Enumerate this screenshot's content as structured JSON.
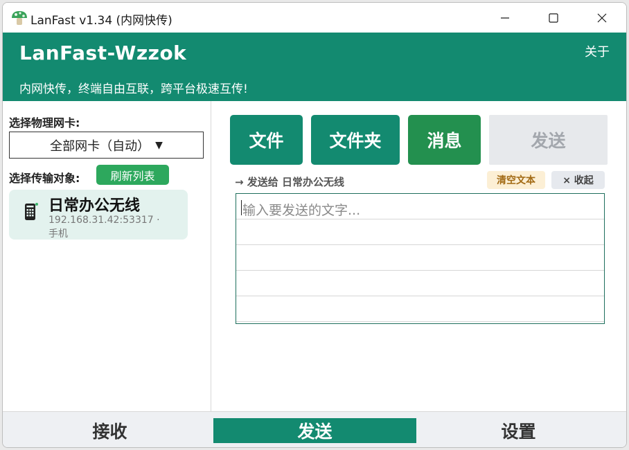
{
  "window": {
    "title": "LanFast v1.34 (内网快传)"
  },
  "header": {
    "title": "LanFast-Wzzok",
    "subtitle": "内网快传，终端自由互联，跨平台极速互传!",
    "about_label": "关于"
  },
  "left": {
    "nic_label": "选择物理网卡:",
    "nic_value": "全部网卡（自动）",
    "target_label": "选择传输对象:",
    "refresh_label": "刷新列表",
    "device": {
      "name": "日常办公无线",
      "address": "192.168.31.42:53317 ·",
      "type": "手机",
      "icon": "mobile-phone-icon"
    }
  },
  "right": {
    "tabs": {
      "file": "文件",
      "folder": "文件夹",
      "message": "消息",
      "send": "发送"
    },
    "send_to": "→ 发送给 日常办公无线",
    "clear_label": "清空文本",
    "collapse_label": "× 收起",
    "input_placeholder": "输入要发送的文字..."
  },
  "bottom_tabs": {
    "receive": "接收",
    "send": "发送",
    "settings": "设置"
  },
  "colors": {
    "brand": "#138a70",
    "message_tab": "#23904f",
    "refresh_button": "#2da85d",
    "clear_chip_bg": "#fcefd5"
  }
}
